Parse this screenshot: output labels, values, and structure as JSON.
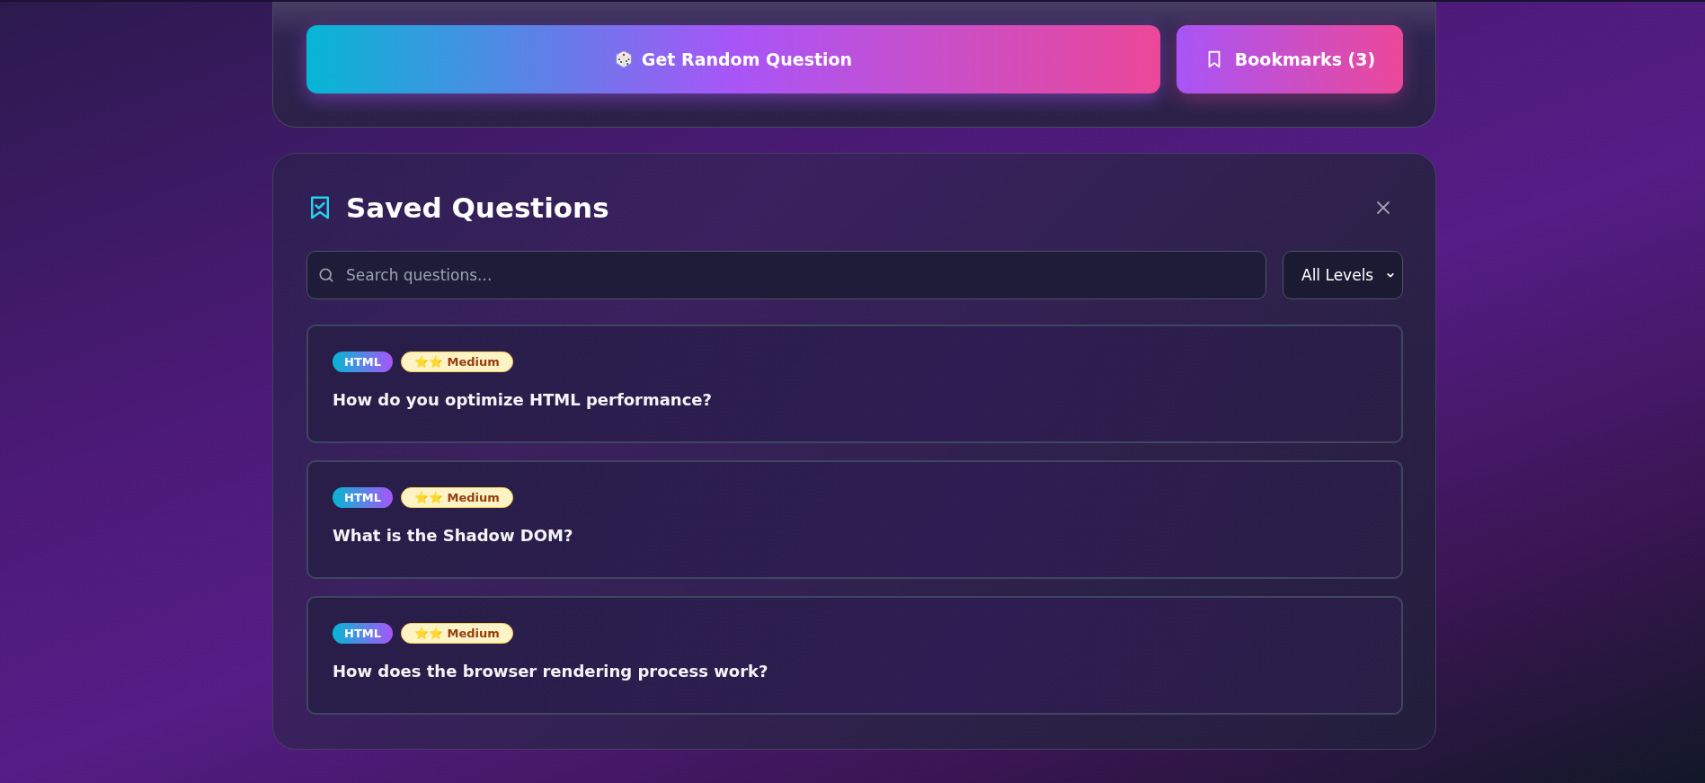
{
  "actions": {
    "random_button": "Get Random Question",
    "bookmarks_button": "Bookmarks (3)"
  },
  "panel": {
    "title": "Saved Questions",
    "search": {
      "placeholder": "Search questions..."
    },
    "level_filter": "All Levels"
  },
  "questions": [
    {
      "tag": "HTML",
      "difficulty": "⭐⭐ Medium",
      "text": "How do you optimize HTML performance?"
    },
    {
      "tag": "HTML",
      "difficulty": "⭐⭐ Medium",
      "text": "What is the Shadow DOM?"
    },
    {
      "tag": "HTML",
      "difficulty": "⭐⭐ Medium",
      "text": "How does the browser rendering process work?"
    }
  ]
}
